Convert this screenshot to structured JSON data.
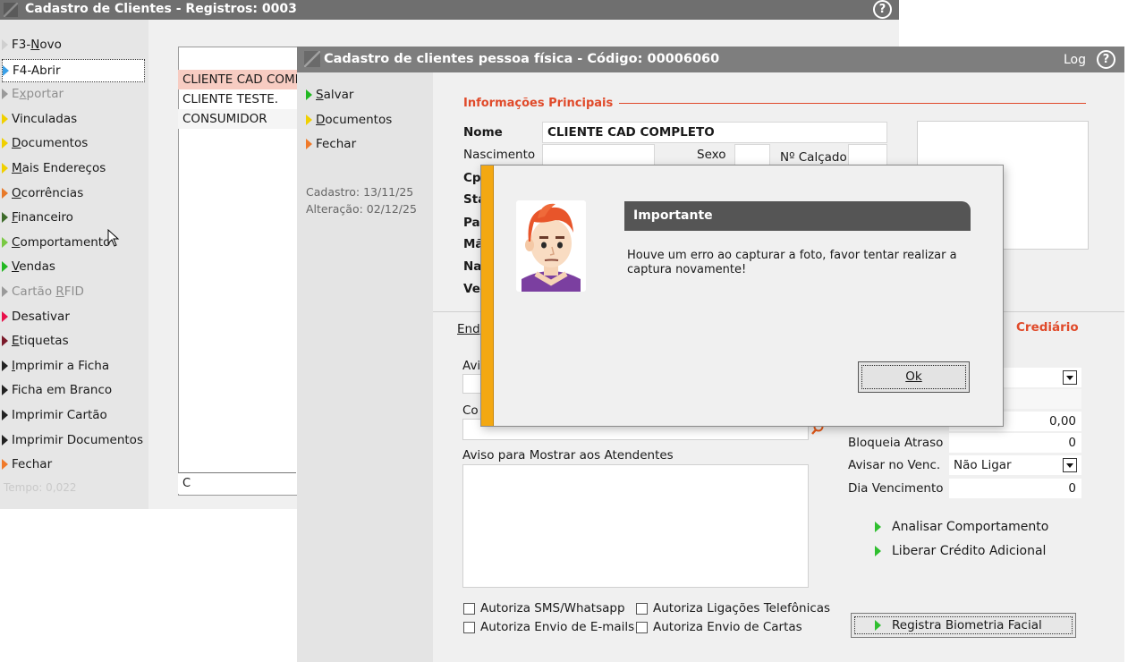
{
  "bg_window": {
    "title": "Cadastro de Clientes - Registros: 0003",
    "help": "?",
    "menu": [
      {
        "label": "F3-Novo",
        "mnemonic": "N",
        "color": "#cfcfcf",
        "state": "normal"
      },
      {
        "label": "F4-Abrir",
        "mnemonic": "",
        "color": "#3aa0e8",
        "state": "selected"
      },
      {
        "label": "Exportar",
        "mnemonic": "x",
        "color": "#9a9a9a",
        "state": "disabled"
      },
      {
        "label": "Vinculadas",
        "mnemonic": "",
        "color": "#f0d000",
        "state": "normal"
      },
      {
        "label": "Documentos",
        "mnemonic": "D",
        "color": "#f0d000",
        "state": "normal"
      },
      {
        "label": "Mais Endereços",
        "mnemonic": "M",
        "color": "#f0d000",
        "state": "normal"
      },
      {
        "label": "Ocorrências",
        "mnemonic": "O",
        "color": "#e87a2a",
        "state": "normal"
      },
      {
        "label": "Financeiro",
        "mnemonic": "F",
        "color": "#3d6b2a",
        "state": "normal"
      },
      {
        "label": "Comportamento",
        "mnemonic": "C",
        "color": "#7ac943",
        "state": "normal"
      },
      {
        "label": "Vendas",
        "mnemonic": "V",
        "color": "#22b822",
        "state": "normal"
      },
      {
        "label": "Cartão RFID",
        "mnemonic": "R",
        "color": "#9a9a9a",
        "state": "disabled"
      },
      {
        "label": "Desativar",
        "mnemonic": "",
        "color": "#e8104a",
        "state": "normal"
      },
      {
        "label": "Etiquetas",
        "mnemonic": "E",
        "color": "#7a1a2a",
        "state": "normal"
      },
      {
        "label": "Imprimir a Ficha",
        "mnemonic": "I",
        "color": "#222222",
        "state": "normal"
      },
      {
        "label": "Ficha em Branco",
        "mnemonic": "",
        "color": "#222222",
        "state": "normal"
      },
      {
        "label": "Imprimir Cartão",
        "mnemonic": "",
        "color": "#222222",
        "state": "normal"
      },
      {
        "label": "Imprimir Documentos",
        "mnemonic": "",
        "color": "#222222",
        "state": "normal"
      },
      {
        "label": "Fechar",
        "mnemonic": "",
        "color": "#f07a2a",
        "state": "normal"
      }
    ],
    "tempo": "Tempo: 0,022",
    "list": [
      "CLIENTE CAD COMPLETO",
      "CLIENTE TESTE.",
      "CONSUMIDOR"
    ],
    "search_value": "C"
  },
  "form": {
    "title": "Cadastro de clientes pessoa física - Código: 00006060",
    "log": "Log",
    "help": "?",
    "actions": [
      {
        "label": "Salvar",
        "mnemonic": "S",
        "color": "#22b822"
      },
      {
        "label": "Documentos",
        "mnemonic": "D",
        "color": "#f0d000"
      },
      {
        "label": "Fechar",
        "mnemonic": "",
        "color": "#f07a2a"
      }
    ],
    "cadastro": "Cadastro: 13/11/25",
    "alteracao": "Alteração: 02/12/25",
    "section_main": "Informações Principais",
    "nome_label": "Nome",
    "nome_value": "CLIENTE CAD COMPLETO",
    "nascimento_label": "Nascimento",
    "sexo_label": "Sexo",
    "calcado_label": "Nº Calçado",
    "partial_labels": [
      "Cpf",
      "Sta",
      "Pai",
      "Mã",
      "Nat",
      "Ver"
    ],
    "tab_end": "End",
    "tab_crediario": "Crediário",
    "aviso_partial": "Avi",
    "co_partial": "Co",
    "aviso_atendentes": "Aviso para Mostrar aos Atendentes",
    "checkboxes": [
      "Autoriza SMS/Whatsapp",
      "Autoriza Ligações Telefônicas",
      "Autoriza Envio de E-mails",
      "Autoriza Envio de Cartas"
    ],
    "credit": {
      "limit_value": "0,00",
      "bloqueia_label": "Bloqueia Atraso",
      "bloqueia_value": "0",
      "avisar_label": "Avisar no Venc.",
      "avisar_value": "Não Ligar",
      "dia_label": "Dia Vencimento",
      "dia_value": "0"
    },
    "links": [
      "Analisar Comportamento",
      "Liberar Crédito Adicional"
    ],
    "biometria": "Registra Biometria Facial"
  },
  "modal": {
    "title": "Importante",
    "message": "Houve um erro ao capturar a foto, favor tentar realizar a captura novamente!",
    "ok": "Ok"
  },
  "colors": {
    "accent_red": "#e04a2a",
    "modal_stripe": "#f3a812",
    "title_bar": "#7e7e7e"
  }
}
